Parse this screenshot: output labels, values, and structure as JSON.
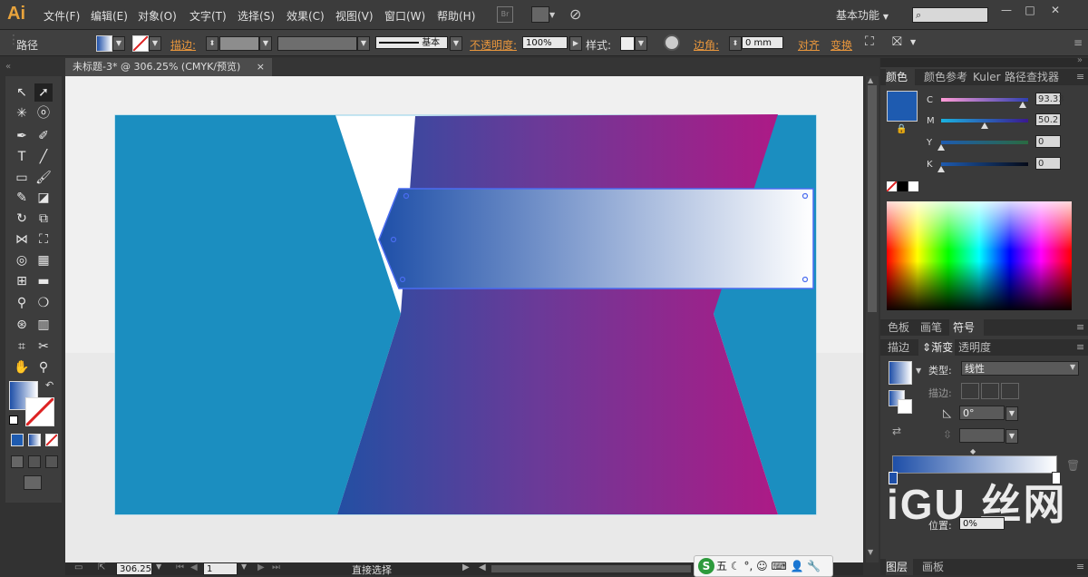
{
  "app": {
    "logo": "Ai"
  },
  "menu": [
    "文件(F)",
    "编辑(E)",
    "对象(O)",
    "文字(T)",
    "选择(S)",
    "效果(C)",
    "视图(V)",
    "窗口(W)",
    "帮助(H)"
  ],
  "menu_icons": {
    "bridge": "Br"
  },
  "workspace": {
    "label": "基本功能"
  },
  "control": {
    "selection_label": "路径",
    "stroke_label": "描边",
    "stroke_style_label": "基本",
    "opacity_label": "不透明度",
    "opacity_value": "100%",
    "style_label": "样式",
    "corner_label": "边角",
    "corner_value": "0 mm",
    "align_label": "对齐",
    "transform_label": "变换"
  },
  "document": {
    "tab_title": "未标题-3* @ 306.25% (CMYK/预览)",
    "close": "×"
  },
  "status": {
    "zoom": "306.25",
    "artboard": "1",
    "tool_name": "直接选择"
  },
  "color_panel": {
    "tabs": [
      "颜色",
      "颜色参考",
      "Kuler",
      "路径查找器"
    ],
    "channels": [
      {
        "label": "C",
        "value": "93.33",
        "fraction": 0.933
      },
      {
        "label": "M",
        "value": "50.2",
        "fraction": 0.502
      },
      {
        "label": "Y",
        "value": "0",
        "fraction": 0
      },
      {
        "label": "K",
        "value": "0",
        "fraction": 0
      }
    ],
    "fill_color": "#1e5bb0"
  },
  "swatch_panel": {
    "tabs": [
      "色板",
      "画笔",
      "符号"
    ]
  },
  "gradient_panel": {
    "tabs": [
      "描边",
      "渐变",
      "透明度"
    ],
    "type_label": "类型",
    "type_value": "线性",
    "stroke_label": "描边",
    "angle_value": "0°",
    "location_label": "位置",
    "location_value": "0%",
    "stop_start": "#1e4fa8",
    "stop_end": "#ffffff"
  },
  "layers_panel": {
    "tabs": [
      "图层",
      "画板"
    ]
  },
  "ime": {
    "label": "五"
  },
  "watermark": {
    "text": "iGU 丝网"
  },
  "colors": {
    "teal": "#1b8ec0",
    "grad_blue": "#234fa3",
    "grad_purple": "#6a3a98",
    "grad_magenta": "#ad1a86"
  }
}
